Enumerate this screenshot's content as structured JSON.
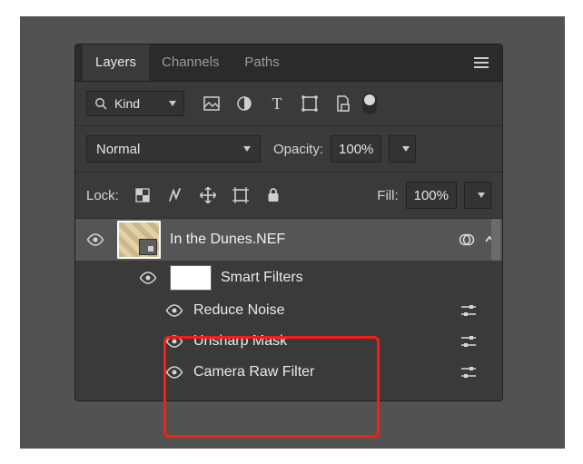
{
  "tabs": {
    "layers": "Layers",
    "channels": "Channels",
    "paths": "Paths"
  },
  "filter": {
    "kind_label": "Kind",
    "icons": [
      "image-layer-icon",
      "adjustment-layer-icon",
      "type-layer-icon",
      "shape-layer-icon",
      "smart-object-icon"
    ]
  },
  "blend": {
    "mode": "Normal",
    "opacity_label": "Opacity:",
    "opacity_value": "100%"
  },
  "lock": {
    "label": "Lock:",
    "fill_label": "Fill:",
    "fill_value": "100%"
  },
  "layers": {
    "main": {
      "name": "In the Dunes.NEF"
    },
    "smart_filters_label": "Smart Filters",
    "filters": [
      {
        "name": "Reduce Noise"
      },
      {
        "name": "Unsharp Mask"
      },
      {
        "name": "Camera Raw Filter"
      }
    ]
  }
}
